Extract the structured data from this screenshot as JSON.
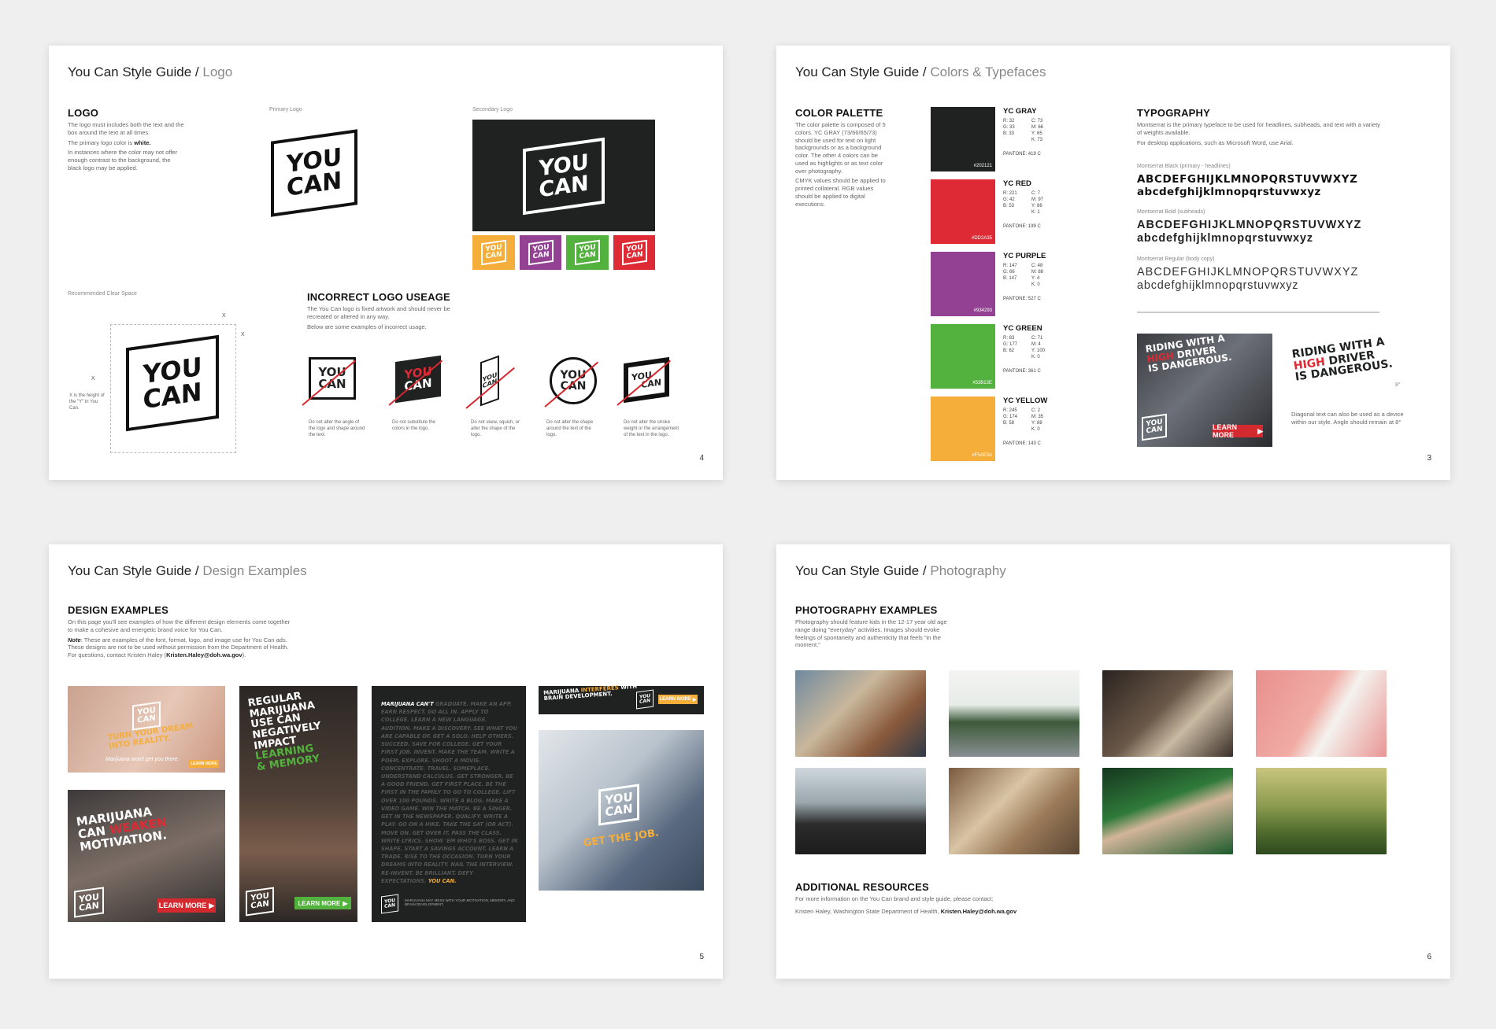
{
  "logo_page": {
    "title": "You Can Style Guide",
    "title_sep": " / ",
    "subtitle": "Logo",
    "heading": "LOGO",
    "text1": "The logo must  includes both the text and the box around the text at all times.",
    "text2_pre": "The primary logo color is ",
    "text2_bold": "white.",
    "text3": "In instances where the color may not offer enough contrast to the background, the black logo may be applied.",
    "primary_label": "Primary Logo",
    "secondary_label": "Secondary Logo",
    "clear_label": "Recommended Clear Space",
    "x_note": "X is the height of the \"Y\" in You Can.",
    "x_mark": "X",
    "logo_line1": "YOU",
    "logo_line2": "CAN",
    "incorrect_heading": "INCORRECT LOGO USEAGE",
    "incorrect_text1": "The You Can logo is fixed artwork and should never be recreated or altered in any way.",
    "incorrect_text2": "Below are some examples of incorrect usage.",
    "incorrect_captions": [
      "Do not alter the angle of the logo and shape around the text.",
      "Do not substitute the colors in the logo.",
      "Do not skew, squish, or alter the shape of the logo.",
      "Do not alter the shape around the text of the logo.",
      "Do not alter the stroke weight or the arrangement of the text in the logo."
    ],
    "page_number": "4"
  },
  "colors_page": {
    "title": "You Can Style Guide",
    "title_sep": " / ",
    "subtitle": "Colors & Typefaces",
    "heading": "COLOR PALETTE",
    "text1": "The color palette is composed of 5 colors. YC GRAY (73/66/65/73) should be used for text on light backgrounds or as a background color. The other 4 colors can be used as highlights or as text color over photography.",
    "text2": "CMYK values should be applied to printed collateral. RGB values should be applied to digital executions.",
    "colors": [
      {
        "name": "YC GRAY",
        "hex": "#202121",
        "rgb": "R: 32\nG: 33\nB: 33",
        "cmyk": "C: 73\nM: 66\nY: 65\nK: 73",
        "pantone": "PANTONE: 419 C"
      },
      {
        "name": "YC RED",
        "hex": "#DD2A35",
        "rgb": "R: 221\nG: 42\nB: 53",
        "cmyk": "C: 7\nM: 97\nY: 86\nK: 1",
        "pantone": "PANTONE: 199 C"
      },
      {
        "name": "YC PURPLE",
        "hex": "#934293",
        "rgb": "R: 147\nG: 66\nB: 147",
        "cmyk": "C: 48\nM: 88\nY: 4\nK: 0",
        "pantone": "PANTONE: 527 C"
      },
      {
        "name": "YC GREEN",
        "hex": "#53B13E",
        "rgb": "R: 83\nG: 177\nB: 62",
        "cmyk": "C: 71\nM: 4\nY: 100\nK: 0",
        "pantone": "PANTONE: 361 C"
      },
      {
        "name": "YC YELLOW",
        "hex": "#F5AE3A",
        "rgb": "R: 245\nG: 174\nB: 58",
        "cmyk": "C: 2\nM: 35\nY: 88\nK: 0",
        "pantone": "PANTONE: 143 C"
      }
    ],
    "typo_heading": "TYPOGRAPHY",
    "typo_text1": "Montserrat is the primary typeface to be used for headlines, subheads, and text with a variety of weights available.",
    "typo_text2": "For desktop applications, such as Microsoft Word, use Arial.",
    "fonts": [
      {
        "label": "Montserrat Black (primary - headlines)",
        "upper": "ABCDEFGHIJKLMNOPQRSTUVWXYZ",
        "lower": "abcdefghijklmnopqrstuvwxyz"
      },
      {
        "label": "Montserrat Bold (subheads)",
        "upper": "ABCDEFGHIJKLMNOPQRSTUVWXYZ",
        "lower": "abcdefghijklmnopqrstuvwxyz"
      },
      {
        "label": "Montserrat Regular (body copy)",
        "upper": "ABCDEFGHIJKLMNOPQRSTUVWXYZ",
        "lower": "abcdefghijklmnopqrstuvwxyz"
      }
    ],
    "ad_line1": "RIDING WITH A",
    "ad_line2": "HIGH",
    "ad_line2b": " DRIVER",
    "ad_line3": "IS DANGEROUS.",
    "ad_button": "LEARN MORE",
    "logo_line1": "YOU",
    "logo_line2": "CAN",
    "diagonal_note": "Diagonal text can also be used as a device within our style. Angle should remain at 8°",
    "angle_mark": "8°",
    "page_number": "3"
  },
  "design_page": {
    "title": "You Can Style Guide",
    "title_sep": " / ",
    "subtitle": "Design Examples",
    "heading": "DESIGN EXAMPLES",
    "text1": "On this page you'll see examples of how the different design elements come together to make a cohesive and energetic brand voice for You Can.",
    "note_label": "Note",
    "note_text": ": These are examples of the font, format, logo, and image use for You Can ads. These designs are not to be used without permission from the Department of Health. For questions, contact Kristen Haley (",
    "note_email": "Kristen.Haley@doh.wa.gov",
    "note_end": ").",
    "ad1_line1": "TURN YOUR DREAM",
    "ad1_line2": "INTO REALITY.",
    "ad1_line3": "Marijuana won't get you there.",
    "ad1_button": "LEARN MORE",
    "ad2_line1": "MARIJUANA",
    "ad2_line2": "CAN",
    "ad2_line2b": "WEAKEN",
    "ad2_line3": "MOTIVATION.",
    "ad2_button": "LEARN MORE",
    "ad3_lines": [
      "REGULAR",
      "MARIJUANA",
      "USE CAN",
      "NEGATIVELY",
      "IMPACT"
    ],
    "ad3_hl1": "LEARNING",
    "ad3_hl2": "& MEMORY",
    "ad3_button": "LEARN MORE",
    "ad4_head": "MARIJUANA CAN'T",
    "ad4_body": "GRADUATE. MAKE AN APP. EARN RESPECT. GO ALL IN. APPLY TO COLLEGE. LEARN A NEW LANGUAGE. AUDITION. MAKE A DISCOVERY. SEE WHAT YOU ARE CAPABLE OF. GET A SOLO. HELP OTHERS. SUCCEED. SAVE FOR COLLEGE. GET YOUR FIRST JOB. INVENT. MAKE THE TEAM. WRITE A POEM. EXPLORE. SHOOT A MOVIE. CONCENTRATE. TRAVEL. SOMEPLACE. UNDERSTAND CALCULUS. GET STRONGER. BE A GOOD FRIEND. GET FIRST PLACE. BE THE FIRST IN THE FAMILY TO GO TO COLLEGE. LIFT OVER 100 POUNDS. WRITE A BLOG. MAKE A VIDEO GAME. WIN THE MATCH. BE A SINGER. GET IN THE NEWSPAPER. QUALIFY. WRITE A PLAY. GO ON A HIKE. TAKE THE SAT (OR ACT). MOVE ON. GET OVER IT. PASS THE CLASS. WRITE LYRICS. SHOW 'EM WHO'S BOSS. GET IN SHAPE. START A SAVINGS ACCOUNT. LEARN A TRADE. RISE TO THE OCCASION. TURN YOUR DREAMS INTO REALITY. NAIL THE INTERVIEW. RE-INVENT. BE BRILLIANT. DEFY EXPECTATIONS.",
    "ad4_end": "YOU CAN.",
    "ad4_foot": "MARIJUANA MAY MESS WITH YOUR MOTIVATION, MEMORY, AND BRAIN DEVELOPMENT.",
    "ad5_line1": "MARIJUANA",
    "ad5_hl": "INTERFERES",
    "ad5_line2b": " WITH",
    "ad5_line3": "BRAIN DEVELOPMENT.",
    "ad5_button": "LEARN MORE",
    "ad6_text": "GET THE JOB.",
    "logo_line1": "YOU",
    "logo_line2": "CAN",
    "page_number": "5"
  },
  "photo_page": {
    "title": "You Can Style Guide",
    "title_sep": " / ",
    "subtitle": "Photography",
    "heading": "PHOTOGRAPHY EXAMPLES",
    "text1": "Photography should feature kids in the 12-17 year old age range doing \"everyday\" activities. Images should evoke feelings of spontaneity and authenticity that feels \"in the moment.\"",
    "resources_heading": "ADDITIONAL RESOURCES",
    "resources_text": "For more information on the You Can brand and style guide, please contact:",
    "contact_pre": "Kristen Haley, Washington State Department of Health, ",
    "contact_email": "Kristen.Haley@doh.wa.gov",
    "photos": [
      "pizza",
      "basketball",
      "guitar",
      "headphones",
      "driving",
      "classroom",
      "graduation",
      "field"
    ],
    "page_number": "6"
  }
}
